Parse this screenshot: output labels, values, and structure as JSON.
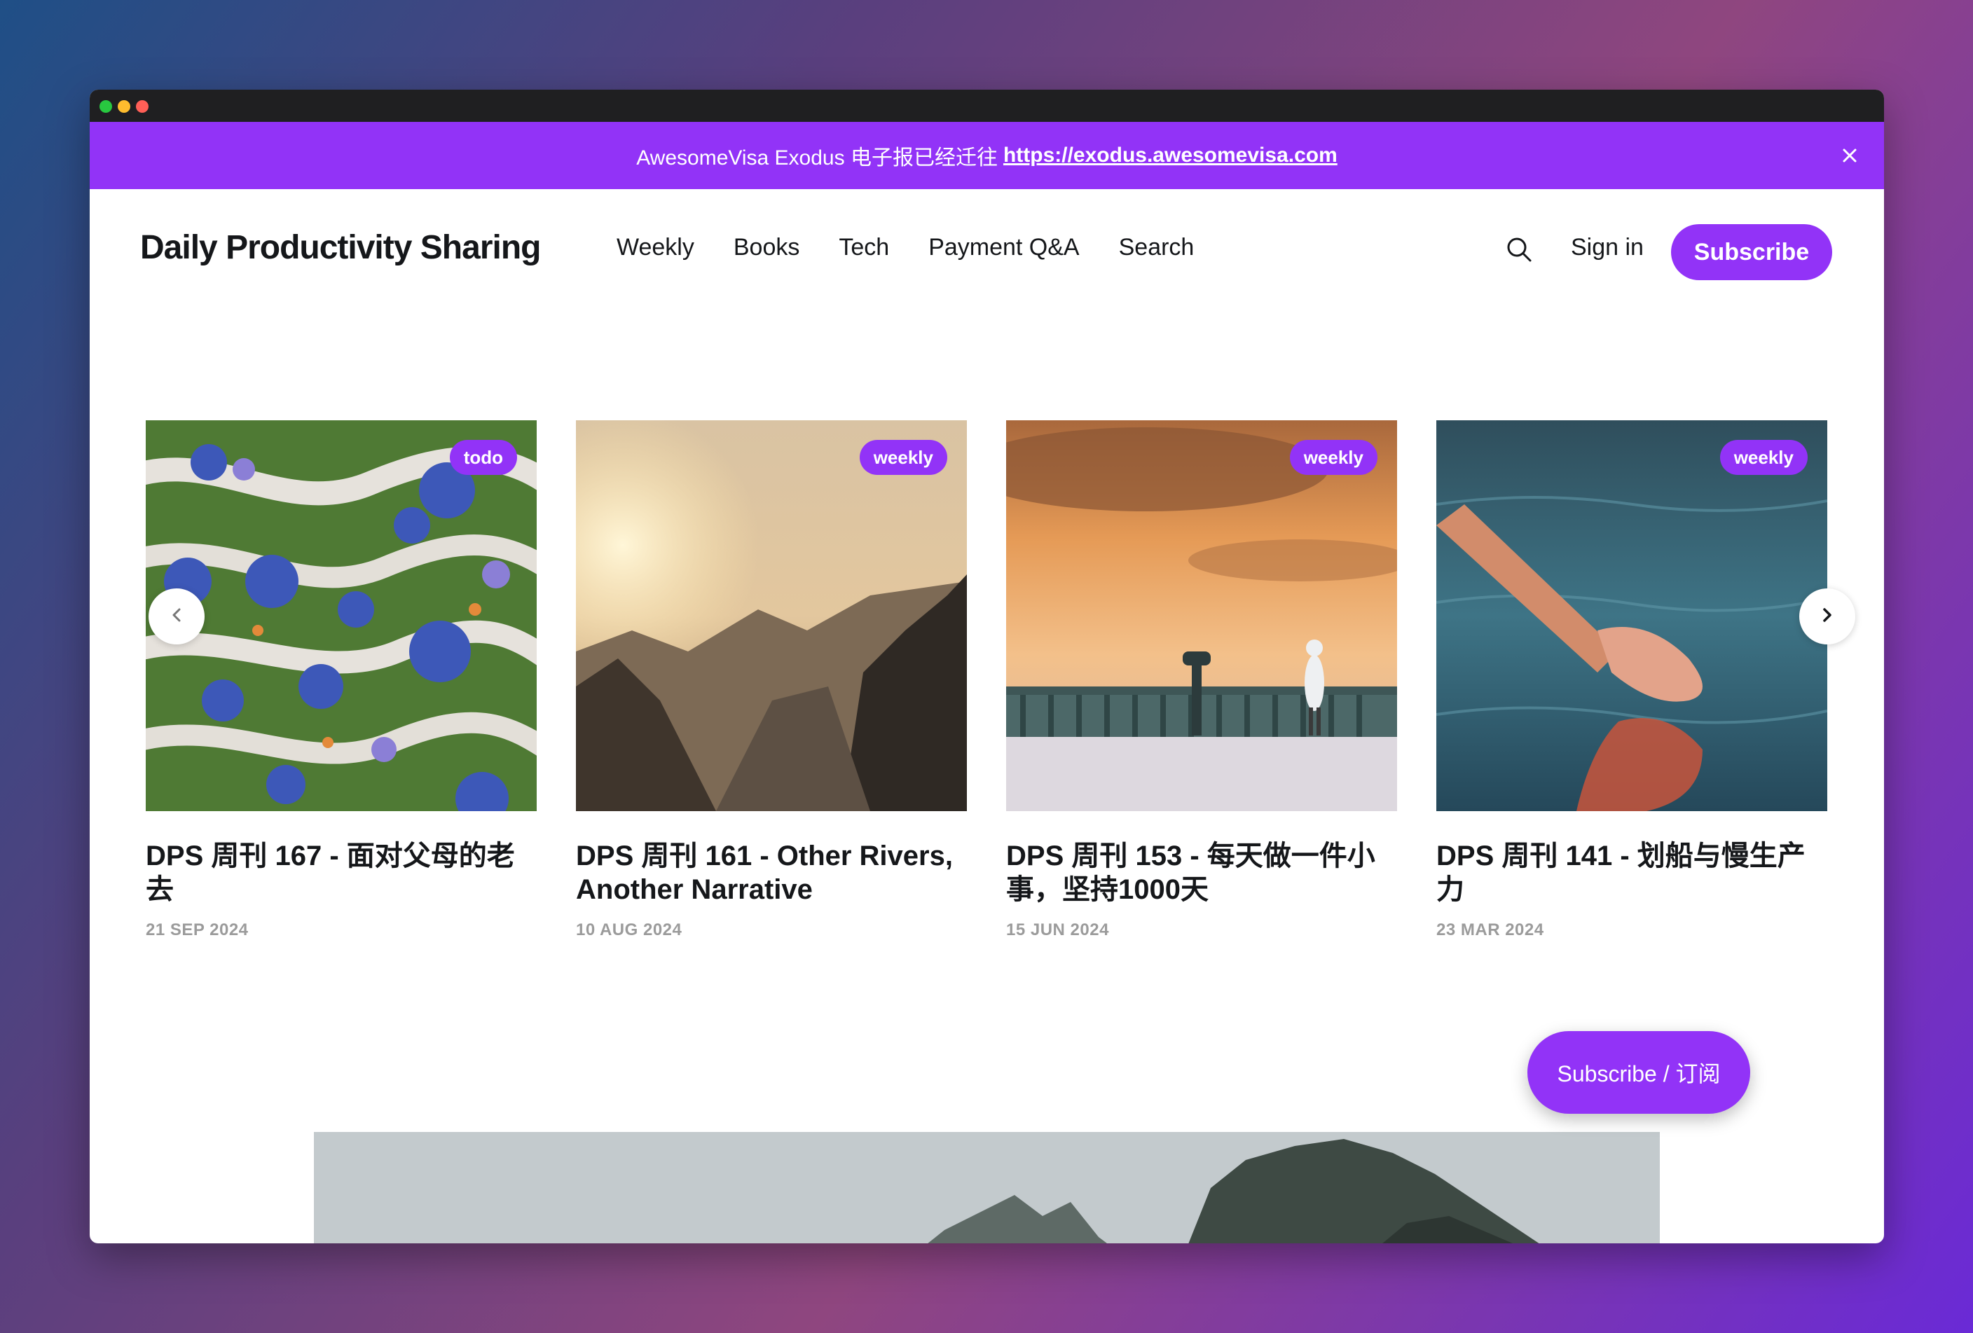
{
  "announcement": {
    "text": "AwesomeVisa Exodus 电子报已经迁往",
    "link": "https://exodus.awesomevisa.com"
  },
  "header": {
    "site_title": "Daily Productivity Sharing",
    "nav": [
      "Weekly",
      "Books",
      "Tech",
      "Payment Q&A",
      "Search"
    ],
    "signin_label": "Sign in",
    "subscribe_label": "Subscribe"
  },
  "posts": [
    {
      "tag": "todo",
      "title": "DPS 周刊 167 - 面对父母的老去",
      "date": "21 SEP 2024"
    },
    {
      "tag": "weekly",
      "title": "DPS 周刊 161 - Other Rivers, Another Narrative",
      "date": "10 AUG 2024"
    },
    {
      "tag": "weekly",
      "title": "DPS 周刊 153 - 每天做一件小事，坚持1000天",
      "date": "15 JUN 2024"
    },
    {
      "tag": "weekly",
      "title": "DPS 周刊 141 - 划船与慢生产力",
      "date": "23 MAR 2024"
    }
  ],
  "floating_subscribe_label": "Subscribe / 订阅",
  "colors": {
    "accent": "#9233f7",
    "text": "#15171a",
    "muted": "#9b9b9b"
  },
  "icons": {
    "close": "close-icon",
    "search": "search-icon",
    "prev": "chevron-left-icon",
    "next": "chevron-right-icon"
  }
}
